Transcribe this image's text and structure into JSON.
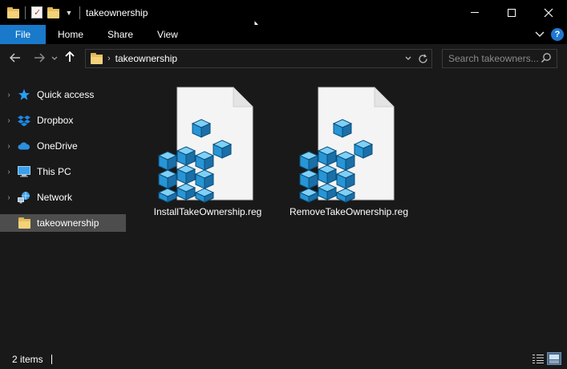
{
  "window": {
    "title": "takeownership"
  },
  "ribbon": {
    "tabs": [
      {
        "label": "File"
      },
      {
        "label": "Home"
      },
      {
        "label": "Share"
      },
      {
        "label": "View"
      }
    ]
  },
  "address_bar": {
    "path": "takeownership"
  },
  "search": {
    "placeholder": "Search takeowners..."
  },
  "sidebar": {
    "items": [
      {
        "label": "Quick access",
        "icon": "star-icon"
      },
      {
        "label": "Dropbox",
        "icon": "dropbox-icon"
      },
      {
        "label": "OneDrive",
        "icon": "cloud-icon"
      },
      {
        "label": "This PC",
        "icon": "computer-icon"
      },
      {
        "label": "Network",
        "icon": "network-icon"
      },
      {
        "label": "takeownership",
        "icon": "folder-icon",
        "selected": true
      }
    ]
  },
  "files": [
    {
      "name": "InstallTakeOwnership.reg",
      "icon": "registry-file-icon"
    },
    {
      "name": "RemoveTakeOwnership.reg",
      "icon": "registry-file-icon"
    }
  ],
  "status": {
    "item_count": "2 items"
  },
  "colors": {
    "accent": "#1979ca",
    "background": "#191919",
    "selected": "#4d4d4d"
  }
}
